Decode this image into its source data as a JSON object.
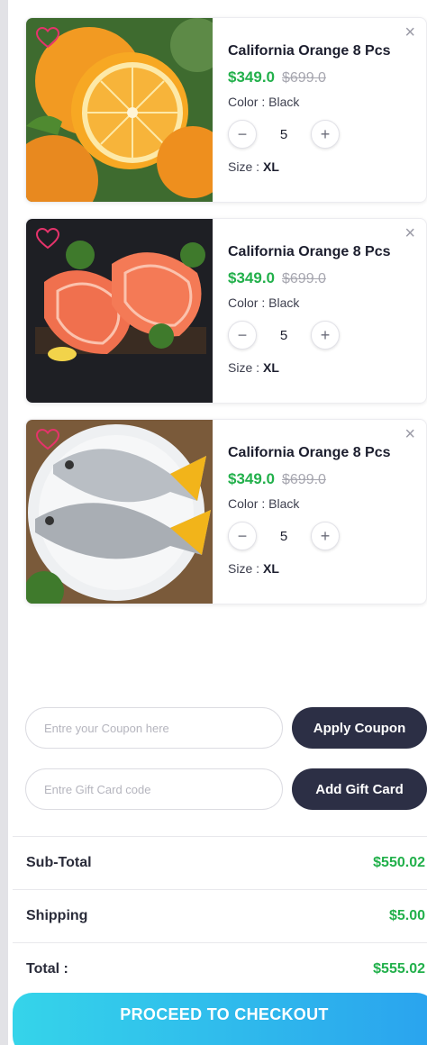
{
  "cart": {
    "items": [
      {
        "title": "California Orange 8 Pcs",
        "price": "$349.0",
        "old_price": "$699.0",
        "color": "Color : Black",
        "quantity": "5",
        "size_label": "Size :",
        "size_value": "XL",
        "image": "orange-photo"
      },
      {
        "title": "California Orange 8 Pcs",
        "price": "$349.0",
        "old_price": "$699.0",
        "color": "Color : Black",
        "quantity": "5",
        "size_label": "Size :",
        "size_value": "XL",
        "image": "salmon-photo"
      },
      {
        "title": "California Orange 8 Pcs",
        "price": "$349.0",
        "old_price": "$699.0",
        "color": "Color : Black",
        "quantity": "5",
        "size_label": "Size :",
        "size_value": "XL",
        "image": "fish-photo"
      }
    ],
    "icons": {
      "wishlist": "heart-icon",
      "remove": "close-icon",
      "decrement": "minus-icon",
      "increment": "plus-icon"
    },
    "remove_glyph": "×",
    "minus_glyph": "−",
    "plus_glyph": "+"
  },
  "coupon": {
    "placeholder": "Entre your Coupon here",
    "button_label": "Apply Coupon"
  },
  "gift_card": {
    "placeholder": "Entre Gift Card code",
    "button_label": "Add Gift Card"
  },
  "summary": {
    "subtotal_label": "Sub-Total",
    "subtotal_value": "$550.02",
    "shipping_label": "Shipping",
    "shipping_value": "$5.00",
    "total_label": "Total :",
    "total_value": "$555.02"
  },
  "checkout": {
    "label": "PROCEED TO CHECKOUT"
  },
  "colors": {
    "price_green": "#22b04b",
    "dark_button": "#2c2f45",
    "checkout_start": "#35d4ea",
    "checkout_end": "#2aa3ee",
    "heart_pink": "#e5336b"
  }
}
